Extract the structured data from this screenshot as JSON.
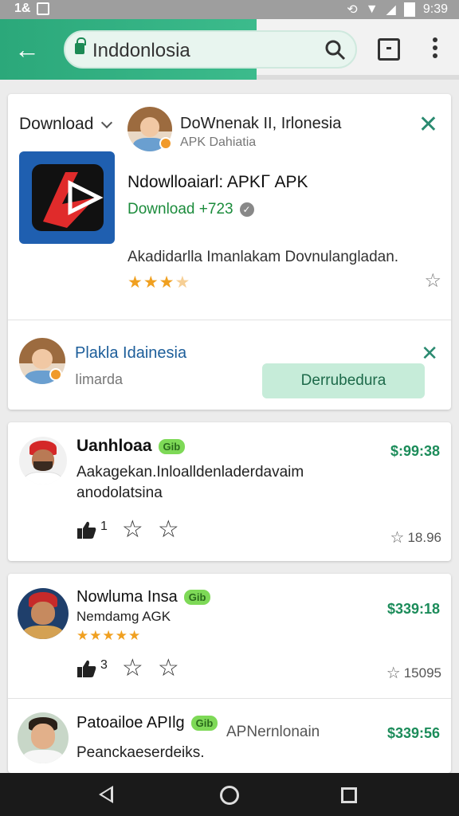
{
  "status_bar": {
    "left_label": "1&",
    "time": "9:39"
  },
  "toolbar": {
    "url": "Inddonlosia",
    "colors": {
      "accent": "#2ba87a"
    }
  },
  "ad_card": {
    "dropdown_label": "Download",
    "advertiser_name": "DoWnenak II, Irlonesia",
    "advertiser_sub": "APK Dahiatia",
    "app_title": "Ndowlloaiarl: APKᒥ APK",
    "app_meta": "Download +723",
    "app_description": "Akadidarlla Imanlakam Dovnulangladan.",
    "rating": 3
  },
  "promo": {
    "name": "Plakla Idainesia",
    "sub": "Iimarda",
    "button_label": "Derrubedura"
  },
  "reviews": [
    {
      "name": "Uanhloaa",
      "badge": "Gib",
      "price": "$:99:38",
      "text_line1": "Aakagekan.Inloalldenladerdavaim",
      "text_line2": "anodolatsina",
      "likes": "1",
      "count": "18.96"
    },
    {
      "name": "Nowlumа Insa",
      "badge": "Gib",
      "price": "$339:18",
      "subtitle": "Nemdamg AGK",
      "stars": "★★★★★",
      "likes": "3",
      "count": "15095"
    },
    {
      "name": "Patoailoe APIlg",
      "badge": "Gib",
      "price": "$339:56",
      "text": "Peanckaeserdeiks.",
      "extra": "APNernlonain"
    }
  ]
}
